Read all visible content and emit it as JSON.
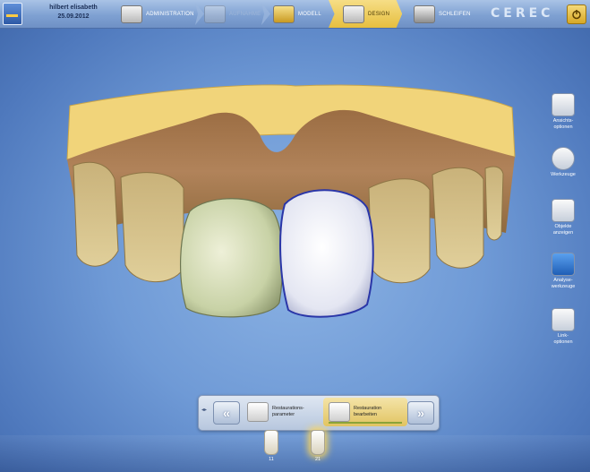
{
  "patient": {
    "name": "hilbert elisabeth",
    "date": "25.09.2012"
  },
  "steps": {
    "administration": "ADMINISTRATION",
    "disabled": "AUFNAHME",
    "model": "MODELL",
    "design": "DESIGN",
    "grind": "SCHLEIFEN"
  },
  "brand": "CEREC",
  "right_toolbar": {
    "view_options": "Ansichts-\noptionen",
    "tools": "Werkzeuge",
    "show_objects": "Objekte\nanzeigen",
    "analysis_tools": "Analyse-\nwerkzeuge",
    "link_options": "Link-\noptionen"
  },
  "phase_bar": {
    "restoration_params": "Restaurations-\nparameter",
    "restoration_edit": "Restauration\nbearbeiten",
    "toggle": "◂▸"
  },
  "teeth": [
    "11",
    "21"
  ],
  "colors": {
    "accent": "#e6bf3f",
    "background": "#6f9ad6",
    "gypsum": "#f1d47a"
  }
}
